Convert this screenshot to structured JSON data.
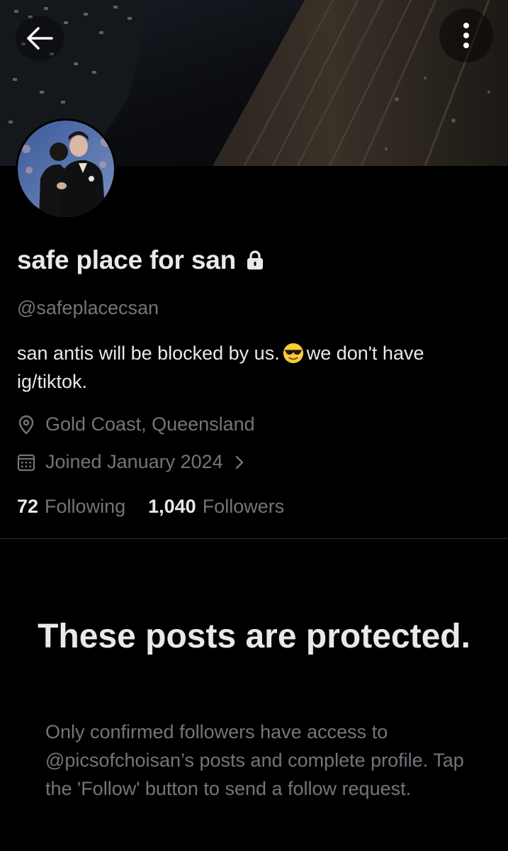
{
  "header": {
    "back_icon": "arrow-left-icon",
    "more_icon": "more-vertical-icon"
  },
  "profile": {
    "display_name": "safe place for san",
    "protected_icon": "lock-icon",
    "handle": "@safeplacecsan",
    "bio_part1": "san antis will be blocked by us.",
    "bio_emoji": "😎",
    "bio_part2": "we don't have ig/tiktok.",
    "location_icon": "location-pin-icon",
    "location": "Gold Coast, Queensland",
    "joined_icon": "calendar-icon",
    "joined": "Joined January 2024",
    "following_count": "72",
    "following_label": "Following",
    "followers_count": "1,040",
    "followers_label": "Followers"
  },
  "protected_notice": {
    "title": "These posts are protected.",
    "body": "Only confirmed followers have access to @picsofchoisan’s posts and complete profile. Tap the 'Follow' button to send a follow request."
  },
  "colors": {
    "background": "#000000",
    "primary_text": "#e7e9ea",
    "secondary_text": "#71767b",
    "divider": "#2f3336"
  }
}
